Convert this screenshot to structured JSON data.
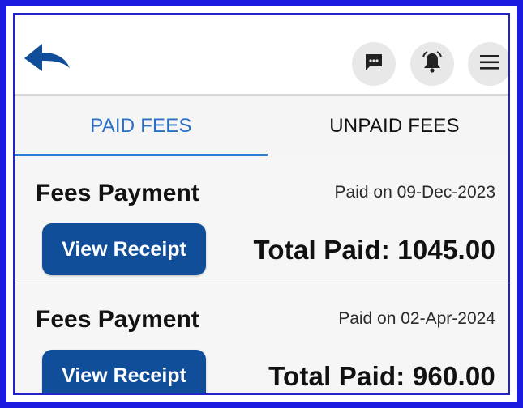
{
  "header": {
    "back_icon": "back-arrow-icon",
    "chat_icon": "chat-icon",
    "bell_icon": "bell-icon",
    "menu_icon": "menu-icon",
    "accent": "#104e9a"
  },
  "tabs": [
    {
      "label": "PAID FEES",
      "active": true,
      "color": "#2a6fc4"
    },
    {
      "label": "UNPAID FEES",
      "active": false,
      "color": "#111111"
    }
  ],
  "payments": [
    {
      "title": "Fees Payment",
      "paid_on": "Paid on 09-Dec-2023",
      "button_label": "View Receipt",
      "total": "Total Paid: 1045.00"
    },
    {
      "title": "Fees Payment",
      "paid_on": "Paid on 02-Apr-2024",
      "button_label": "View Receipt",
      "total": "Total Paid: 960.00"
    }
  ]
}
